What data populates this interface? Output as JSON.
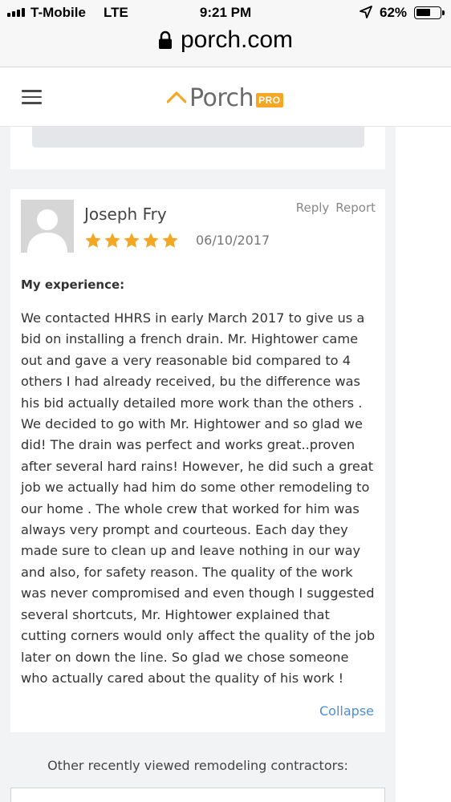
{
  "status_bar": {
    "carrier": "T-Mobile",
    "network": "LTE",
    "time": "9:21 PM",
    "battery": "62%",
    "battery_level": 0.62
  },
  "browser": {
    "url": "porch.com"
  },
  "header": {
    "logo_text": "Porch",
    "logo_badge": "PRO",
    "brand_color": "#f5a623"
  },
  "review": {
    "reviewer_name": "Joseph Fry",
    "reply_label": "Reply",
    "report_label": "Report",
    "rating": 5,
    "date": "06/10/2017",
    "section_label": "My experience:",
    "body": "We contacted HHRS in early March 2017 to give us a bid on installing a french drain.  Mr. Hightower came out and gave a very reasonable bid compared to 4 others I had already received, bu the difference was his bid actually detailed more work than the others .  We decided to go with Mr. Hightower and so glad we did! The drain was perfect and works great..proven after several hard rains!  However, he did such a great job we actually had him do some other remodeling to our home .  The whole crew that worked for him was always very prompt and courteous.  Each day they made sure to clean up and leave nothing in our way and also, for safety reason.  The quality of the work was never compromised and even though I suggested several shortcuts, Mr. Hightower explained that cutting corners would only affect the quality of the job later on down the line.  So glad we chose someone who actually cared about the quality of his work !",
    "collapse_label": "Collapse",
    "star_color": "#f5a623",
    "link_color": "#4a8fd4"
  },
  "other_contractors": {
    "heading": "Other recently viewed remodeling contractors:"
  },
  "icons": [
    "signal-icon",
    "lock-icon",
    "location-arrow-icon",
    "battery-icon",
    "hamburger-menu-icon",
    "porch-logo-icon",
    "star-icon",
    "avatar-placeholder-icon"
  ]
}
